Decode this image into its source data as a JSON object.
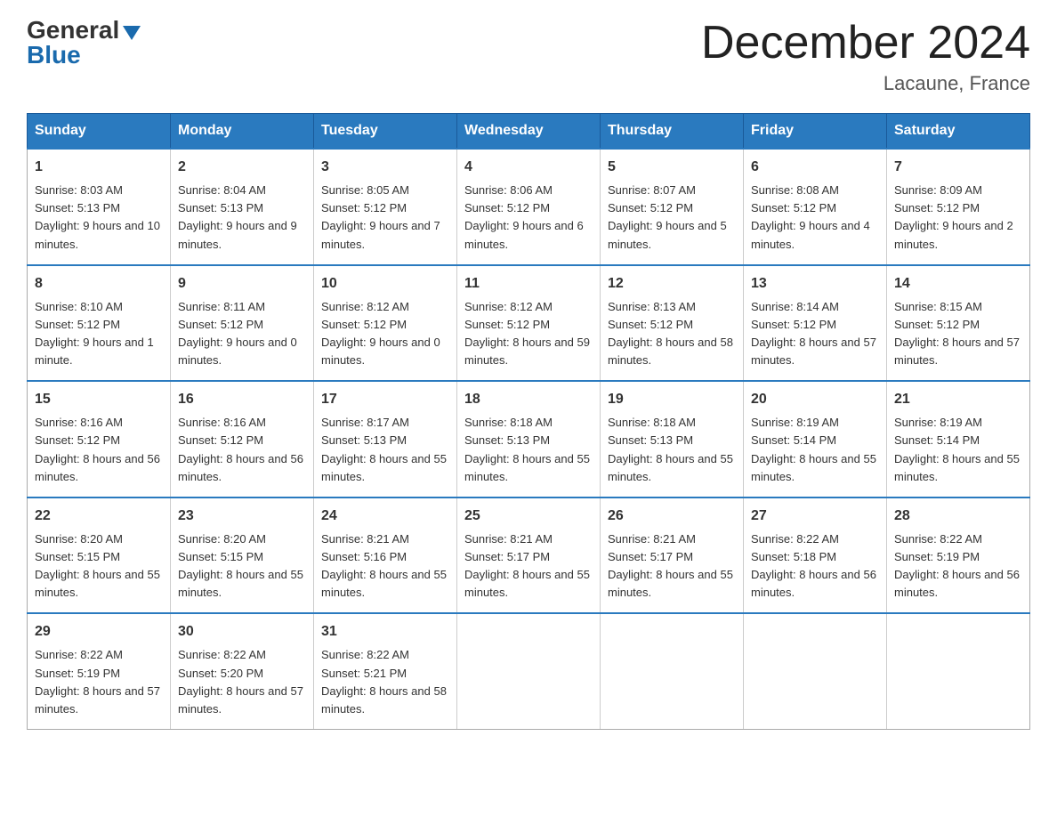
{
  "header": {
    "logo_general": "General",
    "logo_blue": "Blue",
    "month_title": "December 2024",
    "location": "Lacaune, France"
  },
  "days_of_week": [
    "Sunday",
    "Monday",
    "Tuesday",
    "Wednesday",
    "Thursday",
    "Friday",
    "Saturday"
  ],
  "weeks": [
    [
      {
        "day": "1",
        "sunrise": "8:03 AM",
        "sunset": "5:13 PM",
        "daylight": "9 hours and 10 minutes."
      },
      {
        "day": "2",
        "sunrise": "8:04 AM",
        "sunset": "5:13 PM",
        "daylight": "9 hours and 9 minutes."
      },
      {
        "day": "3",
        "sunrise": "8:05 AM",
        "sunset": "5:12 PM",
        "daylight": "9 hours and 7 minutes."
      },
      {
        "day": "4",
        "sunrise": "8:06 AM",
        "sunset": "5:12 PM",
        "daylight": "9 hours and 6 minutes."
      },
      {
        "day": "5",
        "sunrise": "8:07 AM",
        "sunset": "5:12 PM",
        "daylight": "9 hours and 5 minutes."
      },
      {
        "day": "6",
        "sunrise": "8:08 AM",
        "sunset": "5:12 PM",
        "daylight": "9 hours and 4 minutes."
      },
      {
        "day": "7",
        "sunrise": "8:09 AM",
        "sunset": "5:12 PM",
        "daylight": "9 hours and 2 minutes."
      }
    ],
    [
      {
        "day": "8",
        "sunrise": "8:10 AM",
        "sunset": "5:12 PM",
        "daylight": "9 hours and 1 minute."
      },
      {
        "day": "9",
        "sunrise": "8:11 AM",
        "sunset": "5:12 PM",
        "daylight": "9 hours and 0 minutes."
      },
      {
        "day": "10",
        "sunrise": "8:12 AM",
        "sunset": "5:12 PM",
        "daylight": "9 hours and 0 minutes."
      },
      {
        "day": "11",
        "sunrise": "8:12 AM",
        "sunset": "5:12 PM",
        "daylight": "8 hours and 59 minutes."
      },
      {
        "day": "12",
        "sunrise": "8:13 AM",
        "sunset": "5:12 PM",
        "daylight": "8 hours and 58 minutes."
      },
      {
        "day": "13",
        "sunrise": "8:14 AM",
        "sunset": "5:12 PM",
        "daylight": "8 hours and 57 minutes."
      },
      {
        "day": "14",
        "sunrise": "8:15 AM",
        "sunset": "5:12 PM",
        "daylight": "8 hours and 57 minutes."
      }
    ],
    [
      {
        "day": "15",
        "sunrise": "8:16 AM",
        "sunset": "5:12 PM",
        "daylight": "8 hours and 56 minutes."
      },
      {
        "day": "16",
        "sunrise": "8:16 AM",
        "sunset": "5:12 PM",
        "daylight": "8 hours and 56 minutes."
      },
      {
        "day": "17",
        "sunrise": "8:17 AM",
        "sunset": "5:13 PM",
        "daylight": "8 hours and 55 minutes."
      },
      {
        "day": "18",
        "sunrise": "8:18 AM",
        "sunset": "5:13 PM",
        "daylight": "8 hours and 55 minutes."
      },
      {
        "day": "19",
        "sunrise": "8:18 AM",
        "sunset": "5:13 PM",
        "daylight": "8 hours and 55 minutes."
      },
      {
        "day": "20",
        "sunrise": "8:19 AM",
        "sunset": "5:14 PM",
        "daylight": "8 hours and 55 minutes."
      },
      {
        "day": "21",
        "sunrise": "8:19 AM",
        "sunset": "5:14 PM",
        "daylight": "8 hours and 55 minutes."
      }
    ],
    [
      {
        "day": "22",
        "sunrise": "8:20 AM",
        "sunset": "5:15 PM",
        "daylight": "8 hours and 55 minutes."
      },
      {
        "day": "23",
        "sunrise": "8:20 AM",
        "sunset": "5:15 PM",
        "daylight": "8 hours and 55 minutes."
      },
      {
        "day": "24",
        "sunrise": "8:21 AM",
        "sunset": "5:16 PM",
        "daylight": "8 hours and 55 minutes."
      },
      {
        "day": "25",
        "sunrise": "8:21 AM",
        "sunset": "5:17 PM",
        "daylight": "8 hours and 55 minutes."
      },
      {
        "day": "26",
        "sunrise": "8:21 AM",
        "sunset": "5:17 PM",
        "daylight": "8 hours and 55 minutes."
      },
      {
        "day": "27",
        "sunrise": "8:22 AM",
        "sunset": "5:18 PM",
        "daylight": "8 hours and 56 minutes."
      },
      {
        "day": "28",
        "sunrise": "8:22 AM",
        "sunset": "5:19 PM",
        "daylight": "8 hours and 56 minutes."
      }
    ],
    [
      {
        "day": "29",
        "sunrise": "8:22 AM",
        "sunset": "5:19 PM",
        "daylight": "8 hours and 57 minutes."
      },
      {
        "day": "30",
        "sunrise": "8:22 AM",
        "sunset": "5:20 PM",
        "daylight": "8 hours and 57 minutes."
      },
      {
        "day": "31",
        "sunrise": "8:22 AM",
        "sunset": "5:21 PM",
        "daylight": "8 hours and 58 minutes."
      },
      null,
      null,
      null,
      null
    ]
  ],
  "labels": {
    "sunrise": "Sunrise:",
    "sunset": "Sunset:",
    "daylight": "Daylight:"
  }
}
